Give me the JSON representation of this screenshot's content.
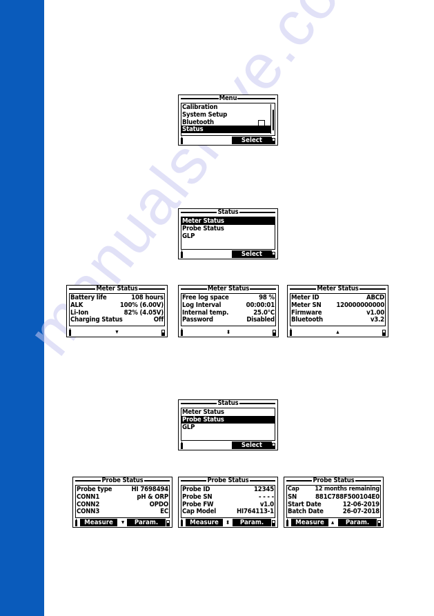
{
  "watermark": "manualshive.com",
  "colors": {
    "sidebar": "#0a5bbb",
    "lcd_text": "#000000",
    "lcd_bg": "#ffffff"
  },
  "screens": {
    "menu": {
      "title": "Menu",
      "items": [
        "Calibration",
        "System Setup",
        "Bluetooth",
        "Status"
      ],
      "selected_index": 3,
      "bluetooth_checkbox": "unchecked",
      "softkey_right": "Select"
    },
    "status_meter": {
      "title": "Status",
      "items": [
        "Meter Status",
        "Probe Status",
        "GLP"
      ],
      "selected_index": 0,
      "softkey_right": "Select"
    },
    "meter_status_1": {
      "title": "Meter Status",
      "rows": [
        {
          "label": "Battery life",
          "value": "108 hours"
        },
        {
          "label": "ALK",
          "value": "100% (6.00V)"
        },
        {
          "label": "Li-Ion",
          "value": "82% (4.05V)"
        },
        {
          "label": "Charging Status",
          "value": "Off"
        }
      ],
      "scroll_icon": "arrow-down"
    },
    "meter_status_2": {
      "title": "Meter Status",
      "rows": [
        {
          "label": "Free log space",
          "value": "98 %"
        },
        {
          "label": "Log Interval",
          "value": "00:00:01"
        },
        {
          "label": "Internal temp.",
          "value": "25.0°C"
        },
        {
          "label": "Password",
          "value": "Disabled"
        }
      ],
      "scroll_icon": "arrow-up-down"
    },
    "meter_status_3": {
      "title": "Meter Status",
      "rows": [
        {
          "label": "Meter ID",
          "value": "ABCD"
        },
        {
          "label": "Meter SN",
          "value": "120000000000"
        },
        {
          "label": "Firmware",
          "value": "v1.00"
        },
        {
          "label": "Bluetooth",
          "value": "v3.2"
        }
      ],
      "scroll_icon": "arrow-up"
    },
    "status_probe": {
      "title": "Status",
      "items": [
        "Meter Status",
        "Probe Status",
        "GLP"
      ],
      "selected_index": 1,
      "softkey_right": "Select"
    },
    "probe_status_1": {
      "title": "Probe Status",
      "rows": [
        {
          "label": "Probe type",
          "value": "HI 7698494"
        },
        {
          "label": "CONN1",
          "value": "pH & ORP"
        },
        {
          "label": "CONN2",
          "value": "OPDO"
        },
        {
          "label": "CONN3",
          "value": "EC"
        }
      ],
      "softkey_left": "Measure",
      "softkey_right": "Param.",
      "scroll_icon": "arrow-down"
    },
    "probe_status_2": {
      "title": "Probe Status",
      "rows": [
        {
          "label": "Probe ID",
          "value": "12345"
        },
        {
          "label": "Probe SN",
          "value": "- - - -"
        },
        {
          "label": "Probe FW",
          "value": "v1.0"
        },
        {
          "label": "Cap Model",
          "value": "HI764113-1"
        }
      ],
      "softkey_left": "Measure",
      "softkey_right": "Param.",
      "scroll_icon": "arrow-up-down"
    },
    "probe_status_3": {
      "title": "Probe Status",
      "rows": [
        {
          "label": "Cap",
          "value": "12 months remaining"
        },
        {
          "label": "SN",
          "value": "881C788F500104E0"
        },
        {
          "label": "Start Date",
          "value": "12-06-2019"
        },
        {
          "label": "Batch Date",
          "value": "26-07-2018"
        }
      ],
      "softkey_left": "Measure",
      "softkey_right": "Param.",
      "scroll_icon": "arrow-up"
    }
  },
  "glyphs": {
    "arrow-down": "▼",
    "arrow-up": "▲",
    "arrow-up-down": "⬍"
  }
}
